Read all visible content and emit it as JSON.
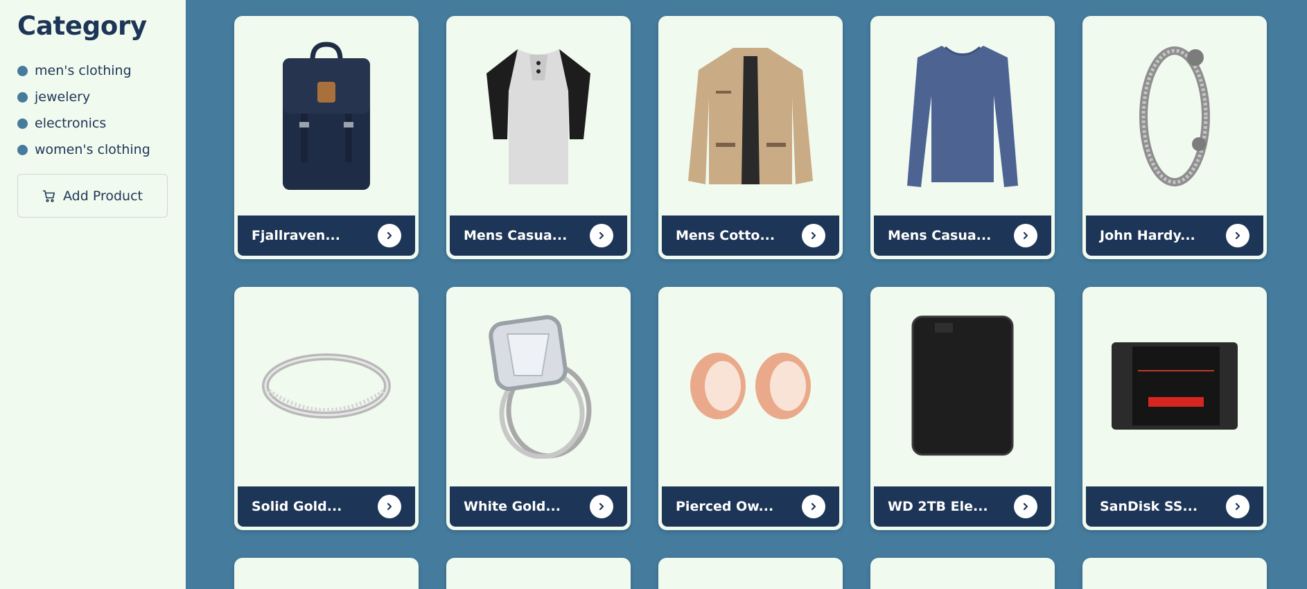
{
  "sidebar": {
    "title": "Category",
    "categories": [
      "men's clothing",
      "jewelery",
      "electronics",
      "women's clothing"
    ],
    "add_button_label": "Add Product",
    "add_button_icon": "cart-icon"
  },
  "products": [
    {
      "name": "Fjallraven...",
      "icon": "backpack-image"
    },
    {
      "name": "Mens Casua...",
      "icon": "tshirt-image"
    },
    {
      "name": "Mens Cotto...",
      "icon": "jacket-image"
    },
    {
      "name": "Mens Casua...",
      "icon": "longsleeve-shirt-image"
    },
    {
      "name": "John Hardy...",
      "icon": "bracelet-image"
    },
    {
      "name": "Solid Gold...",
      "icon": "ring-image"
    },
    {
      "name": "White Gold...",
      "icon": "diamond-ring-image"
    },
    {
      "name": "Pierced Ow...",
      "icon": "ear-plugs-image"
    },
    {
      "name": "WD 2TB Ele...",
      "icon": "hard-drive-image"
    },
    {
      "name": "SanDisk SS...",
      "icon": "ssd-image"
    }
  ],
  "colors": {
    "background": "#457b9d",
    "sidebar": "#f1faee",
    "primary": "#1d3557",
    "accent": "#457b9d"
  }
}
